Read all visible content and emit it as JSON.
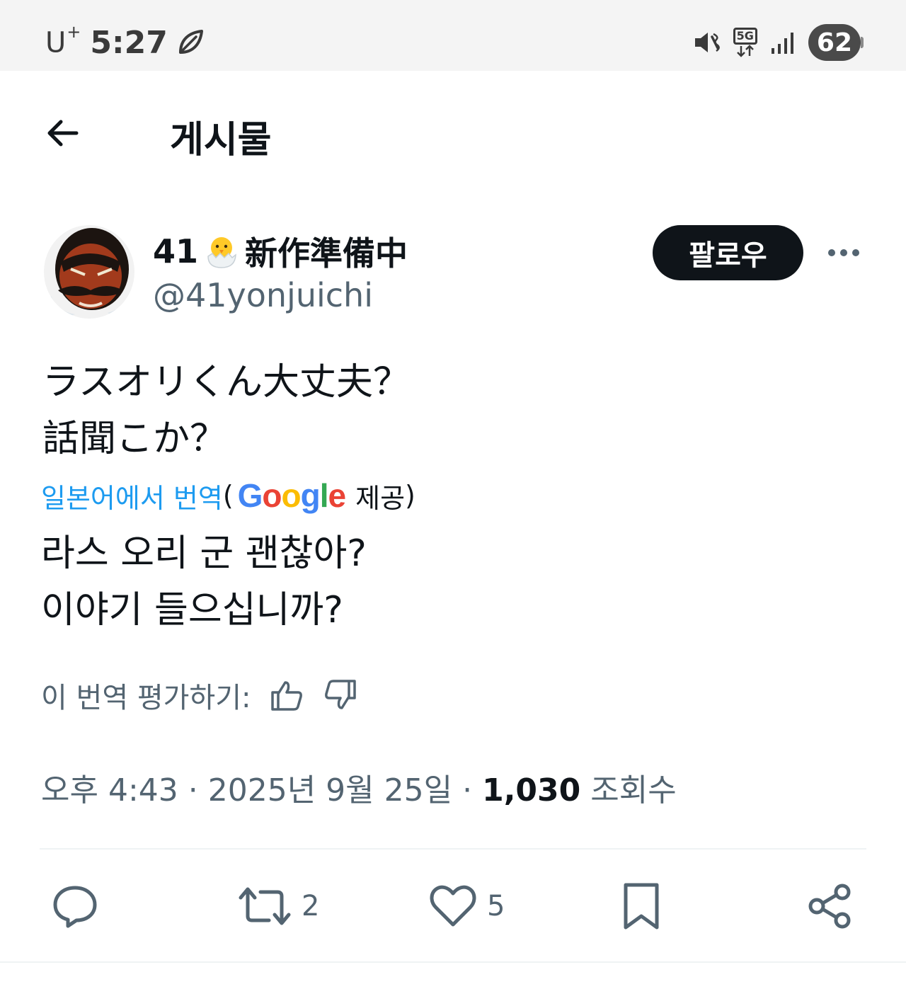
{
  "status_bar": {
    "carrier": "U",
    "carrier_sup": "+",
    "time": "5:27",
    "network": "5G",
    "battery": "62"
  },
  "header": {
    "title": "게시물"
  },
  "author": {
    "display_name_prefix": "41",
    "display_name_suffix": "新作準備中",
    "handle": "@41yonjuichi",
    "follow_label": "팔로우"
  },
  "tweet": {
    "original_lines": [
      "ラスオリくん大丈夫？",
      "話聞こか？"
    ],
    "translate_link": "일본어에서 번역",
    "translate_provider_open": "(",
    "translate_provider": "Google",
    "translate_provided": "제공",
    "translate_provider_close": ")",
    "translated_lines": [
      "라스 오리 군 괜찮아?",
      "이야기 들으십니까?"
    ],
    "rate_label": "이 번역 평가하기:",
    "meta_time": "오후 4:43",
    "meta_sep": " · ",
    "meta_date": "2025년 9월 25일",
    "meta_views_count": "1,030",
    "meta_views_label": "조회수"
  },
  "actions": {
    "reply_count": "",
    "retweet_count": "2",
    "like_count": "5"
  },
  "colors": {
    "accent": "#1d9bf0",
    "text": "#0f1419",
    "secondary": "#536471",
    "follow_bg": "#0f1419"
  }
}
